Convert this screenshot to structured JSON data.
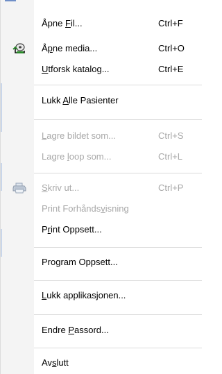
{
  "menu": {
    "items": [
      {
        "id": "open_file",
        "label_parts": [
          "Åpne ",
          "F",
          "il..."
        ],
        "shortcut": "Ctrl+F",
        "enabled": true
      },
      {
        "id": "open_media",
        "label_parts": [
          "Å",
          "p",
          "ne media..."
        ],
        "shortcut": "Ctrl+O",
        "enabled": true,
        "icon": "open-media-icon"
      },
      {
        "id": "explore_catalog",
        "label_parts": [
          "",
          "U",
          "tforsk katalog..."
        ],
        "shortcut": "Ctrl+E",
        "enabled": true
      },
      {
        "id": "close_all_patients",
        "label_parts": [
          "Lukk ",
          "A",
          "lle Pasienter"
        ],
        "shortcut": "",
        "enabled": true
      },
      {
        "id": "save_image_as",
        "label_parts": [
          "",
          "L",
          "agre bildet som..."
        ],
        "shortcut": "Ctrl+S",
        "enabled": false
      },
      {
        "id": "save_loop_as",
        "label_parts": [
          "Lagre ",
          "l",
          "oop som..."
        ],
        "shortcut": "Ctrl+L",
        "enabled": false
      },
      {
        "id": "print",
        "label_parts": [
          "",
          "S",
          "kriv ut..."
        ],
        "shortcut": "Ctrl+P",
        "enabled": false,
        "icon": "printer-icon"
      },
      {
        "id": "print_preview",
        "label_parts": [
          "Print Forhånds",
          "v",
          "isning"
        ],
        "shortcut": "",
        "enabled": false
      },
      {
        "id": "print_setup",
        "label_parts": [
          "P",
          "r",
          "int Oppsett..."
        ],
        "shortcut": "",
        "enabled": true
      },
      {
        "id": "program_setup",
        "label_parts": [
          "Program Oppsett...",
          "",
          ""
        ],
        "shortcut": "",
        "enabled": true
      },
      {
        "id": "close_application",
        "label_parts": [
          "",
          "L",
          "ukk applikasjonen..."
        ],
        "shortcut": "",
        "enabled": true
      },
      {
        "id": "change_password",
        "label_parts": [
          "Endre ",
          "P",
          "assord..."
        ],
        "shortcut": "",
        "enabled": true
      },
      {
        "id": "exit",
        "label_parts": [
          "Av",
          "s",
          "lutt"
        ],
        "shortcut": "",
        "enabled": true
      }
    ]
  },
  "colors": {
    "enabled_text": "#000000",
    "disabled_text": "#a8a8a8",
    "gutter": "#f4f4f4",
    "separator": "#dadada",
    "accent": "#6f8fc8"
  }
}
